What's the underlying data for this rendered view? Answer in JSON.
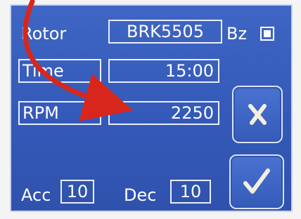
{
  "labels": {
    "rotor": "Rotor",
    "bz": "Bz",
    "acc": "Acc",
    "dec": "Dec"
  },
  "fields": {
    "rotor_value": "BRK5505",
    "time_label": "Time",
    "time_value": "15:00",
    "rpm_label": "RPM",
    "rpm_value": "2250",
    "acc_value": "10",
    "dec_value": "10"
  },
  "bz_checked": true,
  "icons": {
    "cancel": "x-icon",
    "confirm": "checkmark-icon",
    "annotation": "red-arrow-icon"
  },
  "colors": {
    "panel": "#3459b8",
    "text": "#ffffff",
    "arrow": "#d8261c"
  }
}
